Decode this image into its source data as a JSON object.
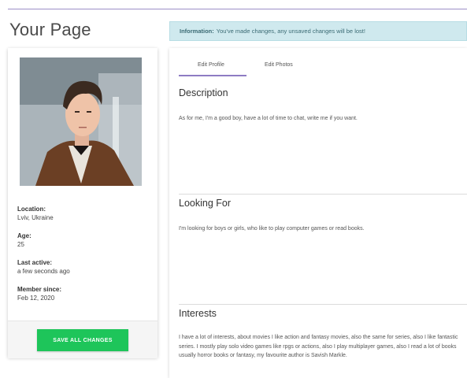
{
  "page": {
    "title": "Your Page"
  },
  "alert": {
    "label": "Information:",
    "message": "You've made changes, any unsaved changes will be lost!"
  },
  "profile": {
    "details": [
      {
        "label": "Location:",
        "value": "Lviv, Ukraine"
      },
      {
        "label": "Age:",
        "value": "25"
      },
      {
        "label": "Last active:",
        "value": "a few seconds ago"
      },
      {
        "label": "Member since:",
        "value": "Feb 12, 2020"
      }
    ],
    "save_label": "SAVE ALL CHANGES"
  },
  "tabs": [
    {
      "label": "Edit Profile",
      "active": true
    },
    {
      "label": "Edit Photos",
      "active": false
    }
  ],
  "sections": [
    {
      "title": "Description",
      "text": "As for me, I'm a good boy, have a lot of time to chat, write me if you want."
    },
    {
      "title": "Looking For",
      "text": "I'm looking for boys or girls, who like to play computer games or read books."
    },
    {
      "title": "Interests",
      "text": "I have a lot of interests, about movies I like action and fantasy movies, also the same for series, also I like fantastic series. I mostly play solo video games like rpgs or actions, also I play multiplayer games, also I read a lot of books usually horror books or fantasy, my favourite author is Savish Markle."
    }
  ],
  "colors": {
    "accent": "#8e7cc3",
    "save": "#1ec55a",
    "alert_bg": "#cfe9ee"
  }
}
